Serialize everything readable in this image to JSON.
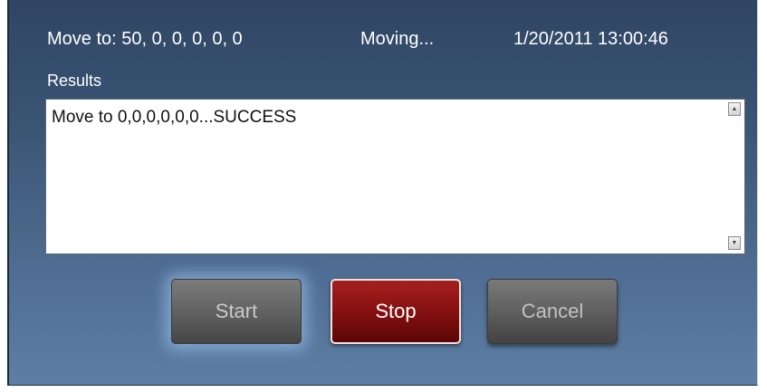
{
  "status": {
    "move_target": "Move to:  50, 0, 0, 0, 0, 0",
    "motion_state": "Moving...",
    "timestamp": "1/20/2011 13:00:46"
  },
  "results": {
    "label": "Results",
    "text": "Move to 0,0,0,0,0,0...SUCCESS"
  },
  "scrollbar": {
    "up_icon": "▲",
    "down_icon": "▼"
  },
  "buttons": {
    "start_label": "Start",
    "stop_label": "Stop",
    "cancel_label": "Cancel"
  },
  "colors": {
    "panel_top": "#2f4563",
    "panel_bottom": "#5e7ea4",
    "stop_button": "#861010",
    "start_glow": "#aad2ff"
  }
}
